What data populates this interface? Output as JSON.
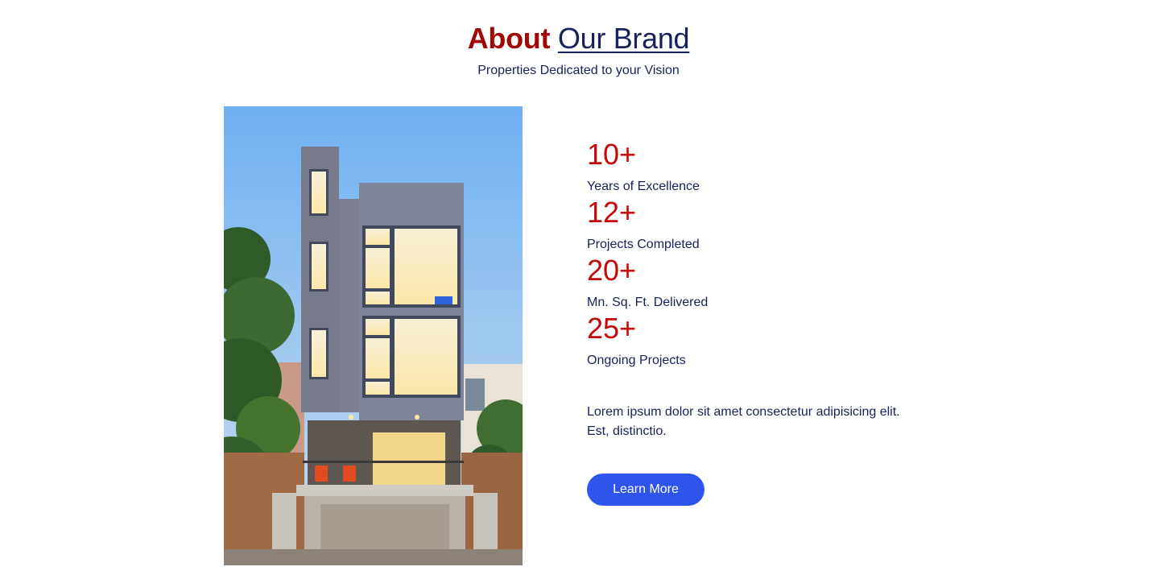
{
  "header": {
    "title_bold": "About",
    "title_light": "Our Brand",
    "subtitle": "Properties Dedicated to your Vision"
  },
  "stats": [
    {
      "value": "10+",
      "label": "Years of Excellence"
    },
    {
      "value": "12+",
      "label": "Projects Completed"
    },
    {
      "value": "20+",
      "label": "Mn. Sq. Ft. Delivered"
    },
    {
      "value": "25+",
      "label": "Ongoing Projects"
    }
  ],
  "description": "Lorem ipsum dolor sit amet consectetur adipisicing elit. Est, distinctio.",
  "cta": {
    "label": "Learn More"
  },
  "colors": {
    "accent_red": "#c40a0a",
    "title_red": "#a10808",
    "navy": "#18225a",
    "button_blue": "#2f54eb"
  }
}
